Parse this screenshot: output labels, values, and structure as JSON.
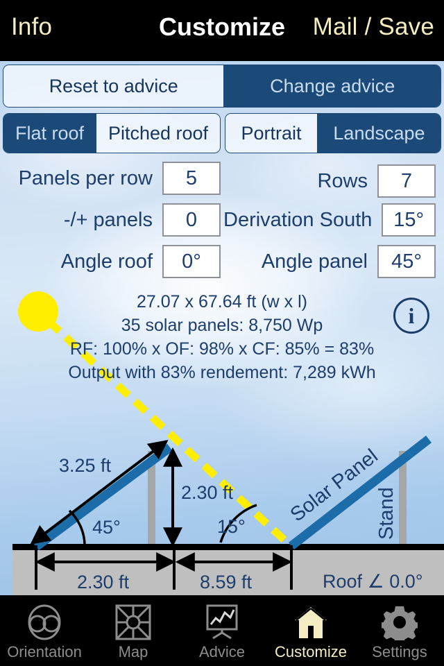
{
  "topbar": {
    "left_button": "Info",
    "title": "Customize",
    "right_button": "Mail / Save"
  },
  "advice_segment": {
    "options": [
      {
        "label": "Reset to advice",
        "selected": true
      },
      {
        "label": "Change advice",
        "selected": false
      }
    ]
  },
  "roof_segment": {
    "options": [
      {
        "label": "Flat roof",
        "selected": false
      },
      {
        "label": "Pitched roof",
        "selected": true
      }
    ]
  },
  "orientation_segment": {
    "options": [
      {
        "label": "Portrait",
        "selected": true
      },
      {
        "label": "Landscape",
        "selected": false
      }
    ]
  },
  "form": {
    "panels_per_row": {
      "label": "Panels per row",
      "value": "5"
    },
    "rows": {
      "label": "Rows",
      "value": "7"
    },
    "plus_minus_panels": {
      "label": "-/+ panels",
      "value": "0"
    },
    "derivation_south": {
      "label": "Derivation South",
      "value": "15°"
    },
    "angle_roof": {
      "label": "Angle roof",
      "value": "0°"
    },
    "angle_panel": {
      "label": "Angle panel",
      "value": "45°"
    }
  },
  "summary": {
    "line1": "27.07 x 67.64 ft (w x l)",
    "line2": "35 solar panels: 8,750 Wp",
    "line3": "RF: 100% x OF: 98% x CF: 85% = 83%",
    "line4": "Output with 83% rendement: 7,289 kWh"
  },
  "info_button": {
    "glyph": "i"
  },
  "diagram": {
    "panel_length_label": "3.25 ft",
    "panel_angle_label": "45°",
    "height_label": "2.30 ft",
    "sun_angle_label": "15°",
    "base_label": "2.30 ft",
    "gap_label": "8.59 ft",
    "panel_name": "Solar Panel",
    "stand_name": "Stand",
    "roof_angle_label": "Roof ∠ 0.0°",
    "colors": {
      "panel_blue": "#1b6ca8",
      "stand_gray": "#a6a6a6",
      "roof_gray": "#bfbfbf",
      "sun_yellow": "#ffee00",
      "line_black": "#000000",
      "text_navy": "#1d3e6d"
    }
  },
  "tabbar": {
    "items": [
      {
        "label": "Orientation",
        "icon": "binoculars-icon",
        "active": false
      },
      {
        "label": "Map",
        "icon": "compass-rose-icon",
        "active": false
      },
      {
        "label": "Advice",
        "icon": "chart-easel-icon",
        "active": false
      },
      {
        "label": "Customize",
        "icon": "house-icon",
        "active": true
      },
      {
        "label": "Settings",
        "icon": "gear-icon",
        "active": false
      }
    ]
  }
}
